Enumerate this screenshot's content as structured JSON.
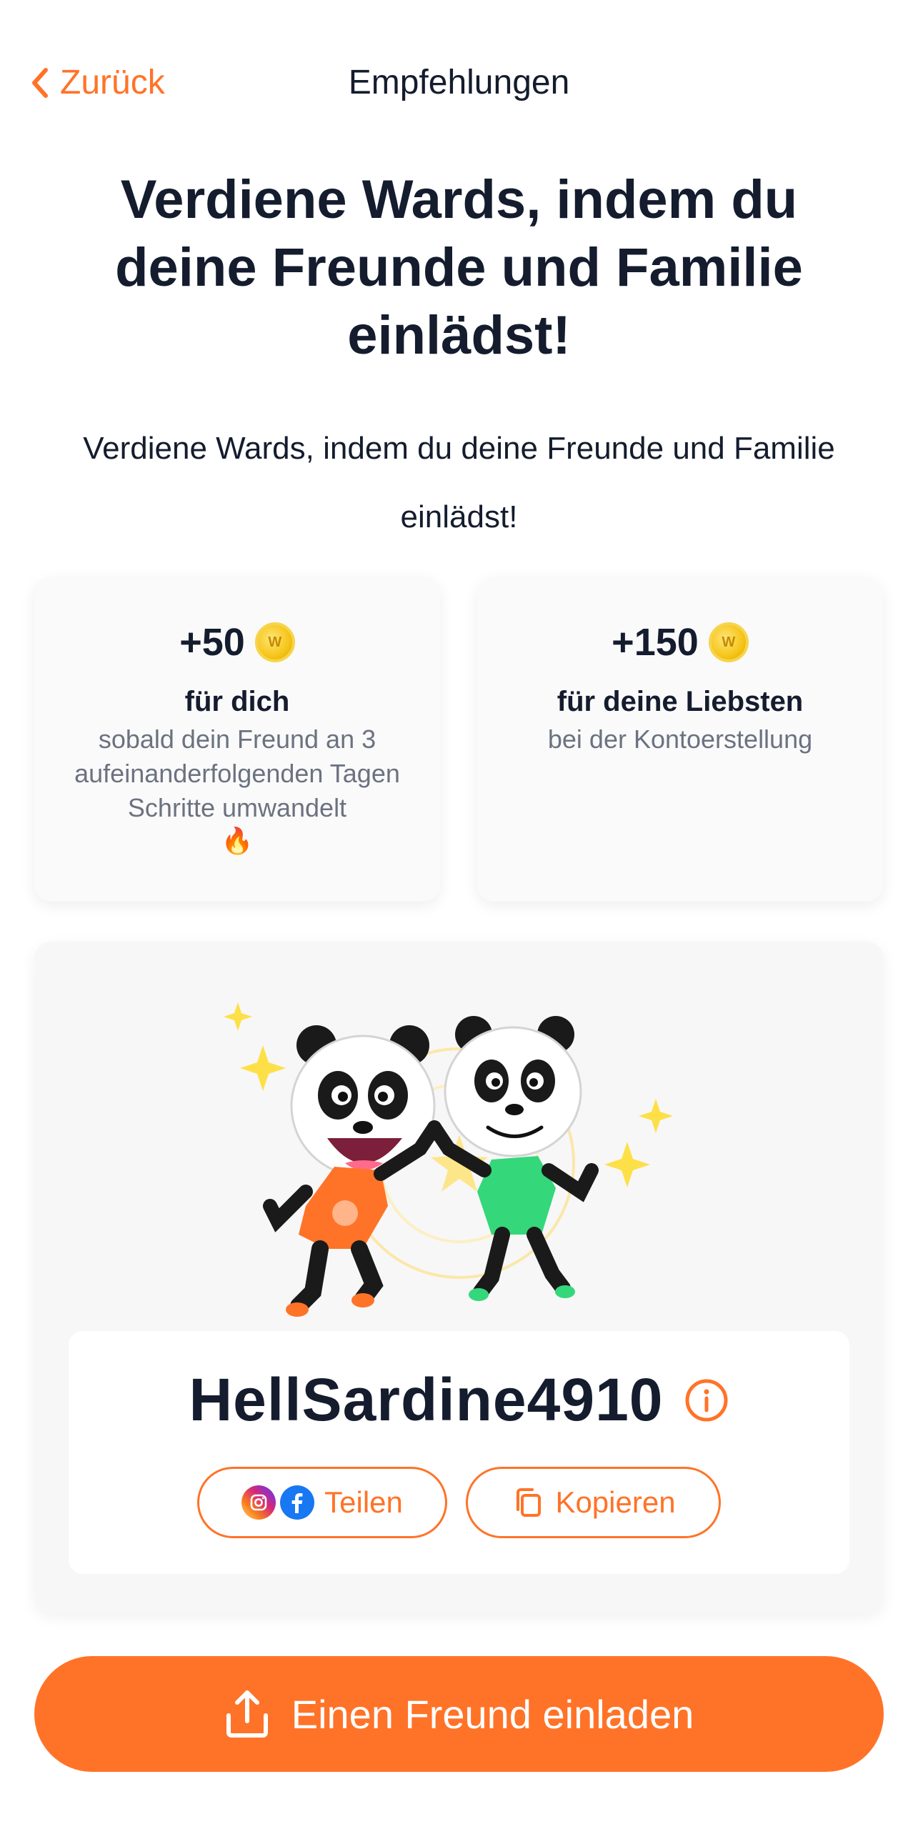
{
  "nav": {
    "back_label": "Zurück",
    "title": "Empfehlungen"
  },
  "hero": {
    "title": "Verdiene Wards, indem du deine Freunde und Familie einlädst!",
    "subtitle": "Verdiene Wards, indem du deine Freunde und Familie einlädst!"
  },
  "rewards": [
    {
      "amount": "+50",
      "coin_letter": "W",
      "heading": "für dich",
      "description": "sobald dein Freund an 3 aufeinanderfolgenden Tagen Schritte umwandelt",
      "emoji": "🔥"
    },
    {
      "amount": "+150",
      "coin_letter": "W",
      "heading": "für deine Liebsten",
      "description": "bei der Kontoerstellung"
    }
  ],
  "invite": {
    "code": "HellSardine4910",
    "share_label": "Teilen",
    "copy_label": "Kopieren"
  },
  "cta": {
    "label": "Einen Freund einladen"
  },
  "colors": {
    "accent": "#ff7328",
    "text": "#141c2e",
    "muted": "#6b7280",
    "card_bg": "#fafafa",
    "coin": "#f5c518"
  },
  "icons": {
    "back": "chevron-left-icon",
    "coin": "ward-coin-icon",
    "info": "info-icon",
    "instagram": "instagram-icon",
    "facebook": "facebook-icon",
    "copy": "copy-icon",
    "share": "share-icon"
  }
}
